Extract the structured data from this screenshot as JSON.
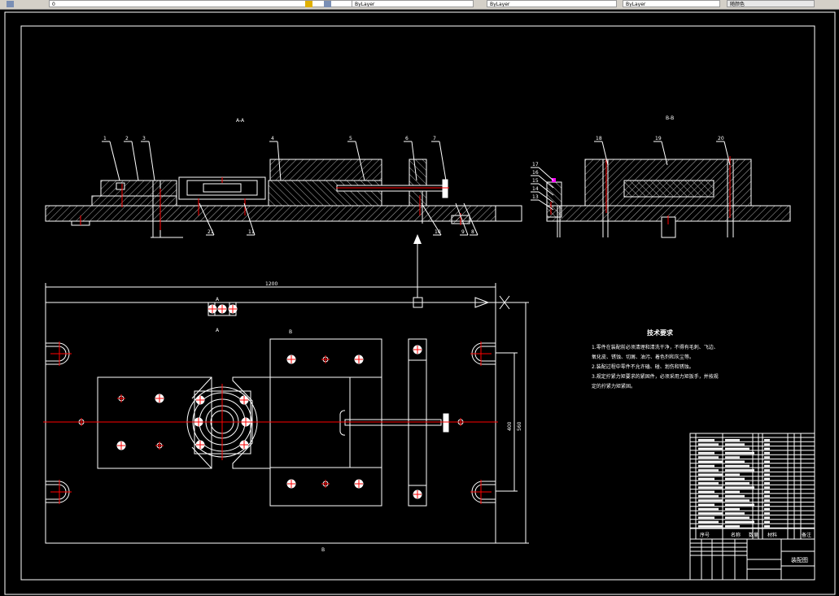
{
  "toolbar": {
    "layer_field": "0",
    "fields": [
      "ByLayer",
      "ByLayer",
      "ByLayer",
      "随颜色"
    ]
  },
  "drawing": {
    "section_aa_label": "A-A",
    "section_bb_label": "B-B",
    "balloons_aa_top": [
      "1",
      "2",
      "3",
      "4",
      "5",
      "6",
      "7"
    ],
    "balloons_aa_bottom": [
      "21",
      "11",
      "10",
      "9",
      "8"
    ],
    "balloons_bb_top": [
      "18",
      "19",
      "20"
    ],
    "balloons_bb_left": [
      "17",
      "16",
      "15",
      "14",
      "13"
    ],
    "plan_dimension_width": "1200",
    "plan_dimension_height": "560",
    "plan_dimension_slot": "400",
    "section_markers": [
      "A",
      "A",
      "B",
      "B"
    ]
  },
  "tech_requirements": {
    "title": "技术要求",
    "lines": [
      "1.零件在装配前必须清理和清洗干净，不得有毛刺、飞边、",
      "氧化皮、锈蚀、切屑、油污、着色剂和灰尘等。",
      "2.装配过程中零件不允许磕、碰、划伤和锈蚀。",
      "3.规定拧紧力矩要求的紧固件，必须采用力矩扳手，并按规",
      "定的拧紧力矩紧固。"
    ]
  },
  "title_block": {
    "headers": [
      "序号",
      "名称",
      "数量",
      "材料",
      "备注"
    ],
    "drawing_name": "装配图"
  },
  "colors": {
    "line": "#ffffff",
    "center": "#ff0000",
    "background": "#000000",
    "magenta": "#ff00ff"
  }
}
